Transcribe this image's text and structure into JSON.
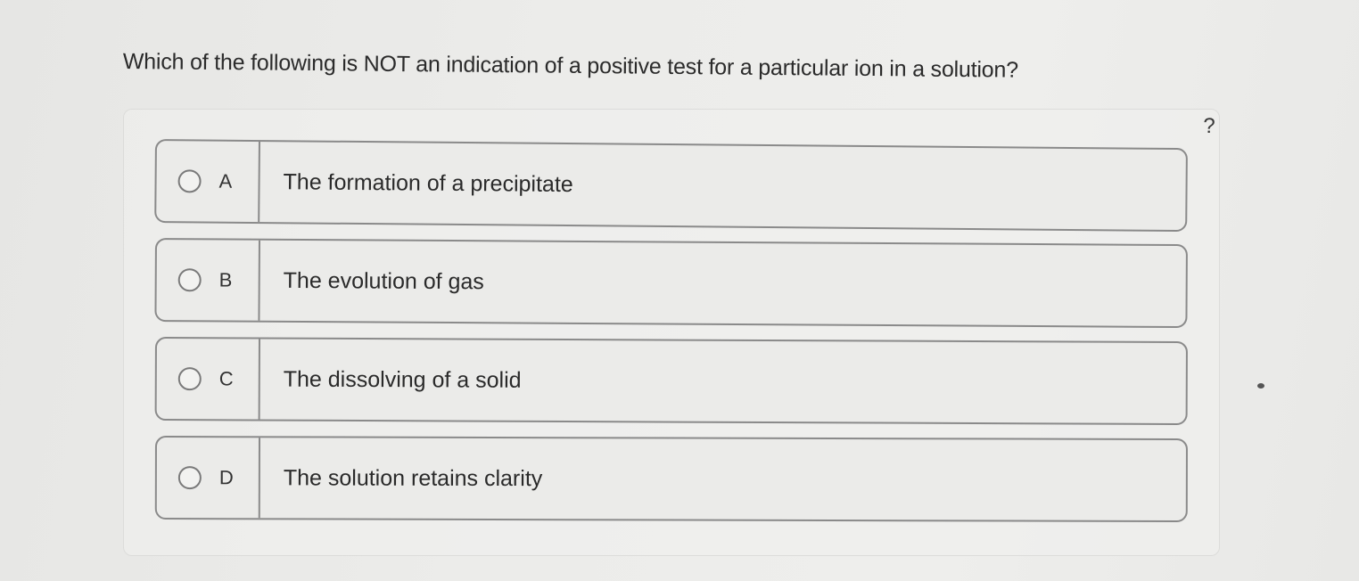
{
  "question": {
    "text": "Which of the following is NOT an indication of a positive test for a particular ion in a solution?"
  },
  "help": {
    "label": "?"
  },
  "options": [
    {
      "letter": "A",
      "text": "The formation of a precipitate"
    },
    {
      "letter": "B",
      "text": "The evolution of gas"
    },
    {
      "letter": "C",
      "text": "The dissolving of a solid"
    },
    {
      "letter": "D",
      "text": "The solution retains clarity"
    }
  ],
  "colors": {
    "border": "#8a8a8a",
    "background": "#ebebe9",
    "text": "#2a2a2a"
  }
}
